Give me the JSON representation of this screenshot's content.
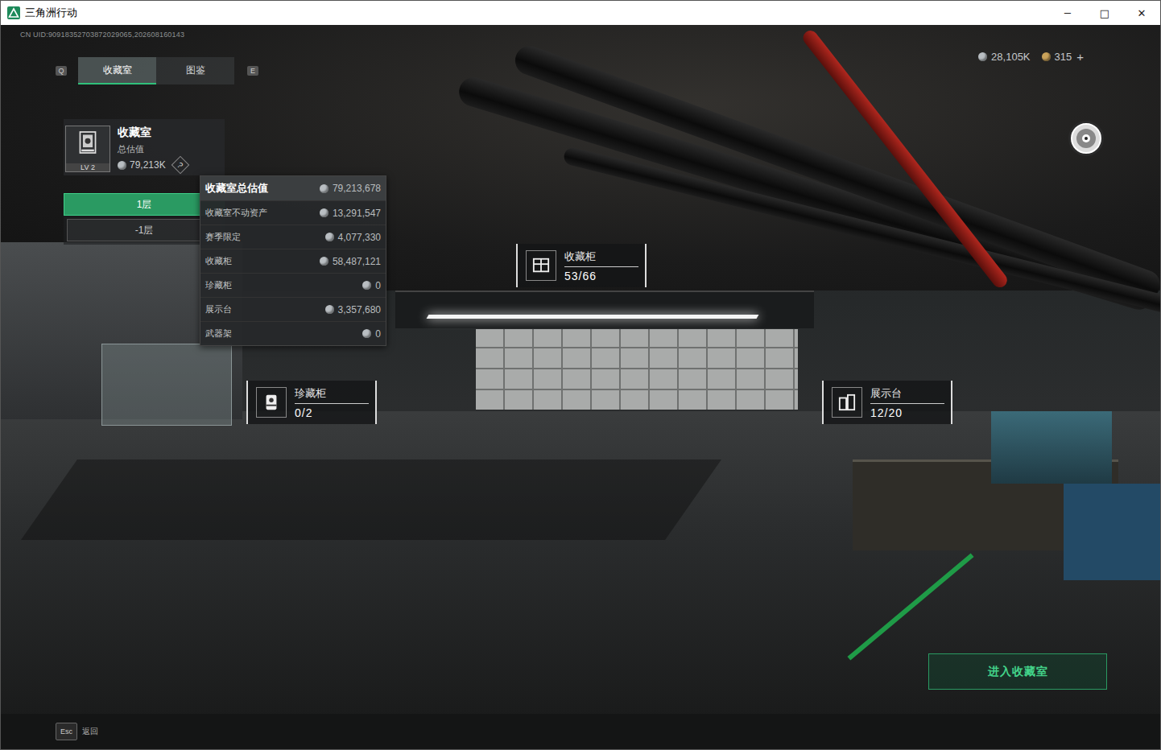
{
  "window": {
    "title": "三角洲行动",
    "controls": [
      "─",
      "□",
      "✕"
    ]
  },
  "uid": "CN UID:90918352703872029065,202608160143",
  "tabs": {
    "prev_key": "Q",
    "next_key": "E",
    "items": [
      {
        "label": "收藏室",
        "selected": true
      },
      {
        "label": "图鉴",
        "selected": false
      }
    ]
  },
  "currency": [
    {
      "amount": "28,105K",
      "color": "#b9bec2"
    },
    {
      "amount": "315",
      "color": "#c9a25a"
    }
  ],
  "currency_add": "+",
  "room_card": {
    "title": "收藏室",
    "subtitle": "总估值",
    "level": "LV 2",
    "value": "79,213K",
    "help": "?"
  },
  "floors": [
    {
      "label": "1层",
      "selected": true
    },
    {
      "label": "-1层",
      "selected": false
    }
  ],
  "tooltip": {
    "title": "收藏室总估值",
    "total": "79,213,678",
    "rows": [
      {
        "label": "收藏室不动资产",
        "value": "13,291,547"
      },
      {
        "label": "赛季限定",
        "value": "4,077,330"
      },
      {
        "label": "收藏柜",
        "value": "58,487,121"
      },
      {
        "label": "珍藏柜",
        "value": "0"
      },
      {
        "label": "展示台",
        "value": "3,357,680"
      },
      {
        "label": "武器架",
        "value": "0"
      }
    ]
  },
  "hotspots": [
    {
      "name": "收藏柜",
      "count": "53/66",
      "kind": "cabinet"
    },
    {
      "name": "珍藏柜",
      "count": "0/2",
      "kind": "vault"
    },
    {
      "name": "展示台",
      "count": "12/20",
      "kind": "stand"
    }
  ],
  "enter_button": "进入收藏室",
  "footer": {
    "key": "Esc",
    "label": "返回"
  }
}
